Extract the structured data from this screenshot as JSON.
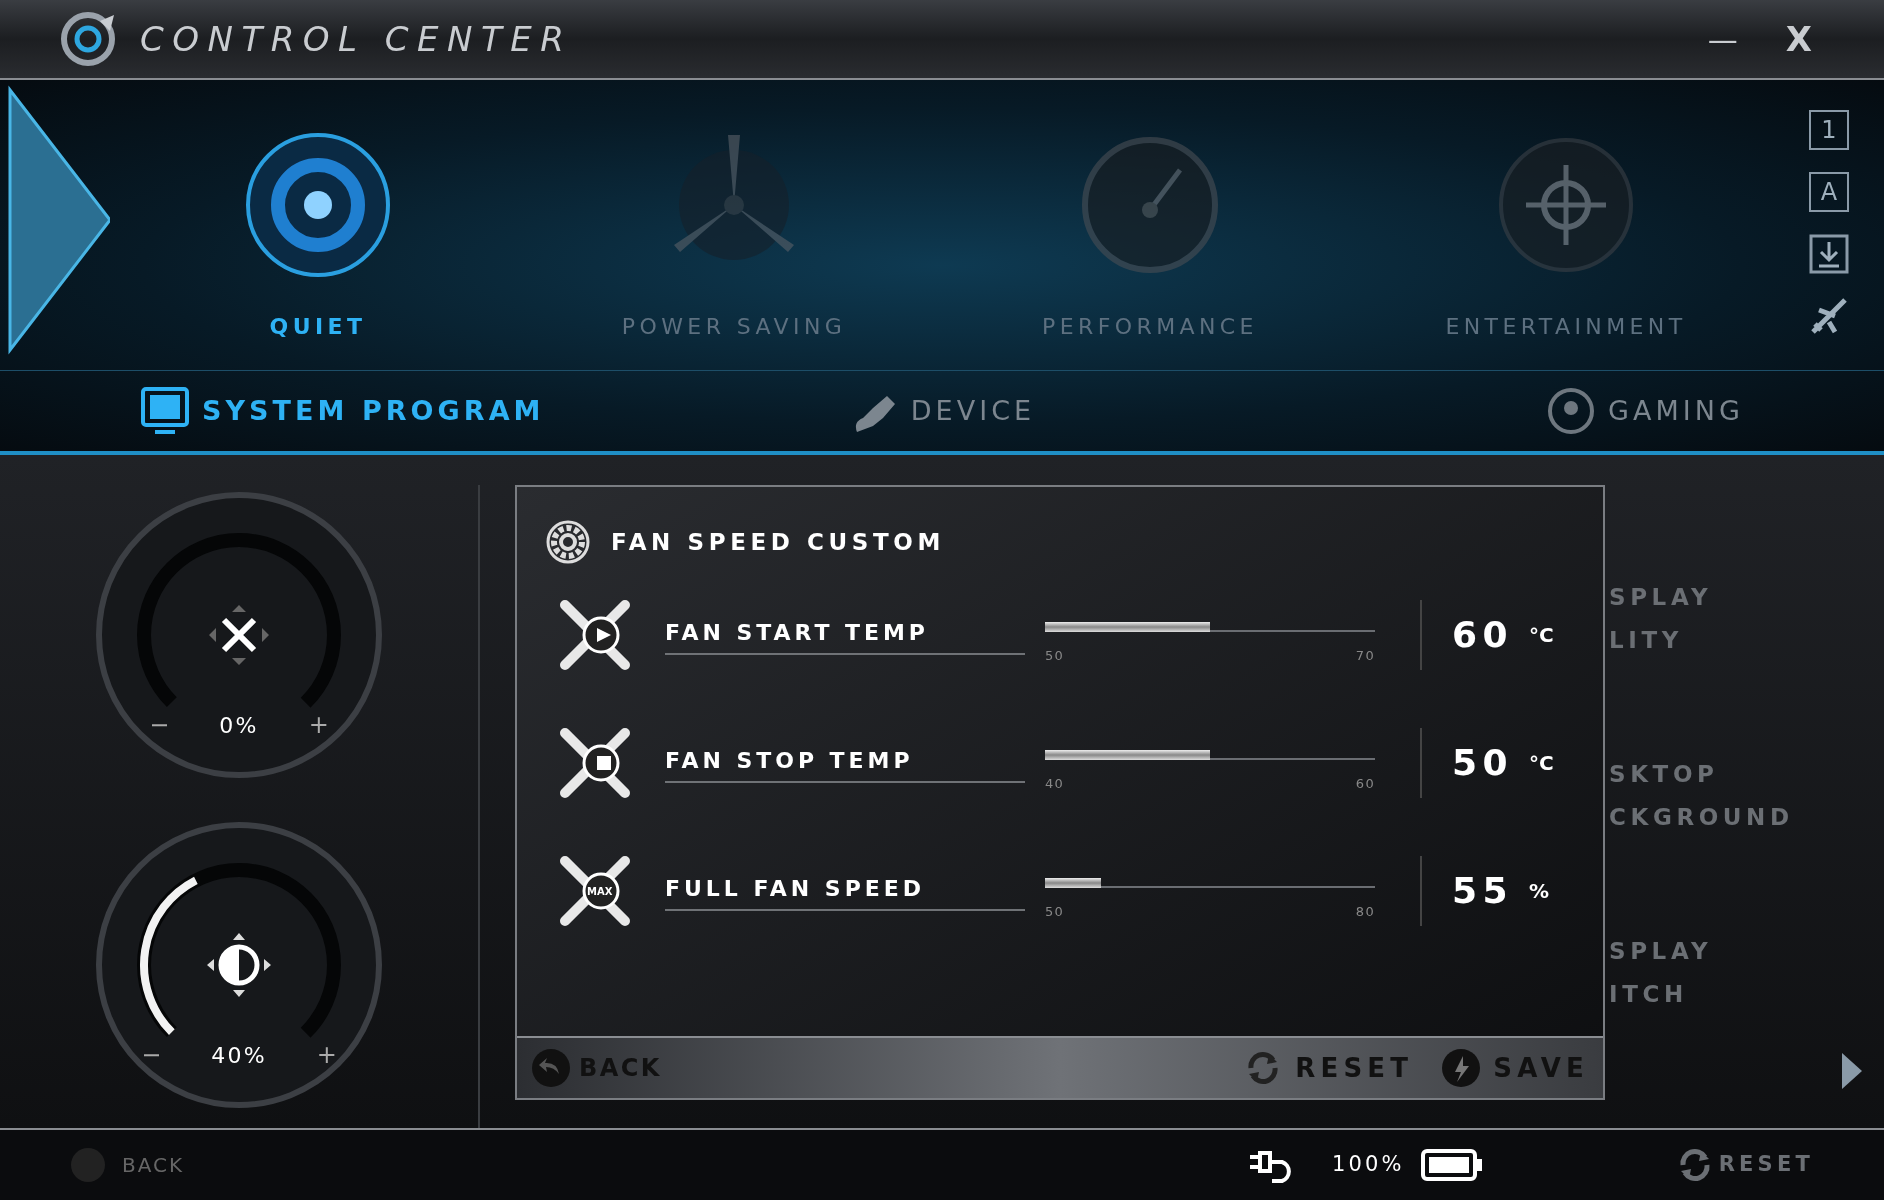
{
  "window": {
    "title": "CONTROL CENTER",
    "minimize": "—",
    "close": "X"
  },
  "modes": [
    {
      "kind": "quiet",
      "label": "QUIET",
      "selected": true
    },
    {
      "kind": "power",
      "label": "POWER SAVING",
      "selected": false
    },
    {
      "kind": "performance",
      "label": "PERFORMANCE",
      "selected": false
    },
    {
      "kind": "entertainment",
      "label": "ENTERTAINMENT",
      "selected": false
    }
  ],
  "side_buttons": [
    {
      "kind": "text",
      "label": "1"
    },
    {
      "kind": "text",
      "label": "A"
    },
    {
      "kind": "download"
    },
    {
      "kind": "airplane"
    }
  ],
  "tabs": [
    {
      "kind": "system",
      "label": "SYSTEM PROGRAM",
      "selected": true
    },
    {
      "kind": "device",
      "label": "DEVICE",
      "selected": false
    },
    {
      "kind": "gaming",
      "label": "GAMING",
      "selected": false
    }
  ],
  "dials": [
    {
      "kind": "volume",
      "reading": "0%",
      "minus": "−",
      "plus": "+"
    },
    {
      "kind": "brightness",
      "reading": "40%",
      "minus": "−",
      "plus": "+"
    }
  ],
  "fan_panel": {
    "title": "FAN SPEED CUSTOM",
    "rows": [
      {
        "kind": "start",
        "label": "FAN START TEMP",
        "min": "50",
        "max": "70",
        "level": 0.5,
        "value": "60",
        "unit": "°C"
      },
      {
        "kind": "stop",
        "label": "FAN STOP TEMP",
        "min": "40",
        "max": "60",
        "level": 0.5,
        "value": "50",
        "unit": "°C"
      },
      {
        "kind": "max",
        "badge": "MAX",
        "label": "FULL FAN SPEED",
        "min": "50",
        "max": "80",
        "level": 0.17,
        "value": "55",
        "unit": "%"
      }
    ],
    "back": "BACK",
    "reset": "RESET",
    "save": "SAVE"
  },
  "right_panel": [
    {
      "lines": [
        "SPLAY",
        "LITY"
      ]
    },
    {
      "lines": [
        "SKTOP",
        "CKGROUND"
      ]
    },
    {
      "lines": [
        "SPLAY",
        "ITCH"
      ]
    }
  ],
  "status_bar": {
    "back": "BACK",
    "battery": "100%",
    "reset": "RESET"
  }
}
